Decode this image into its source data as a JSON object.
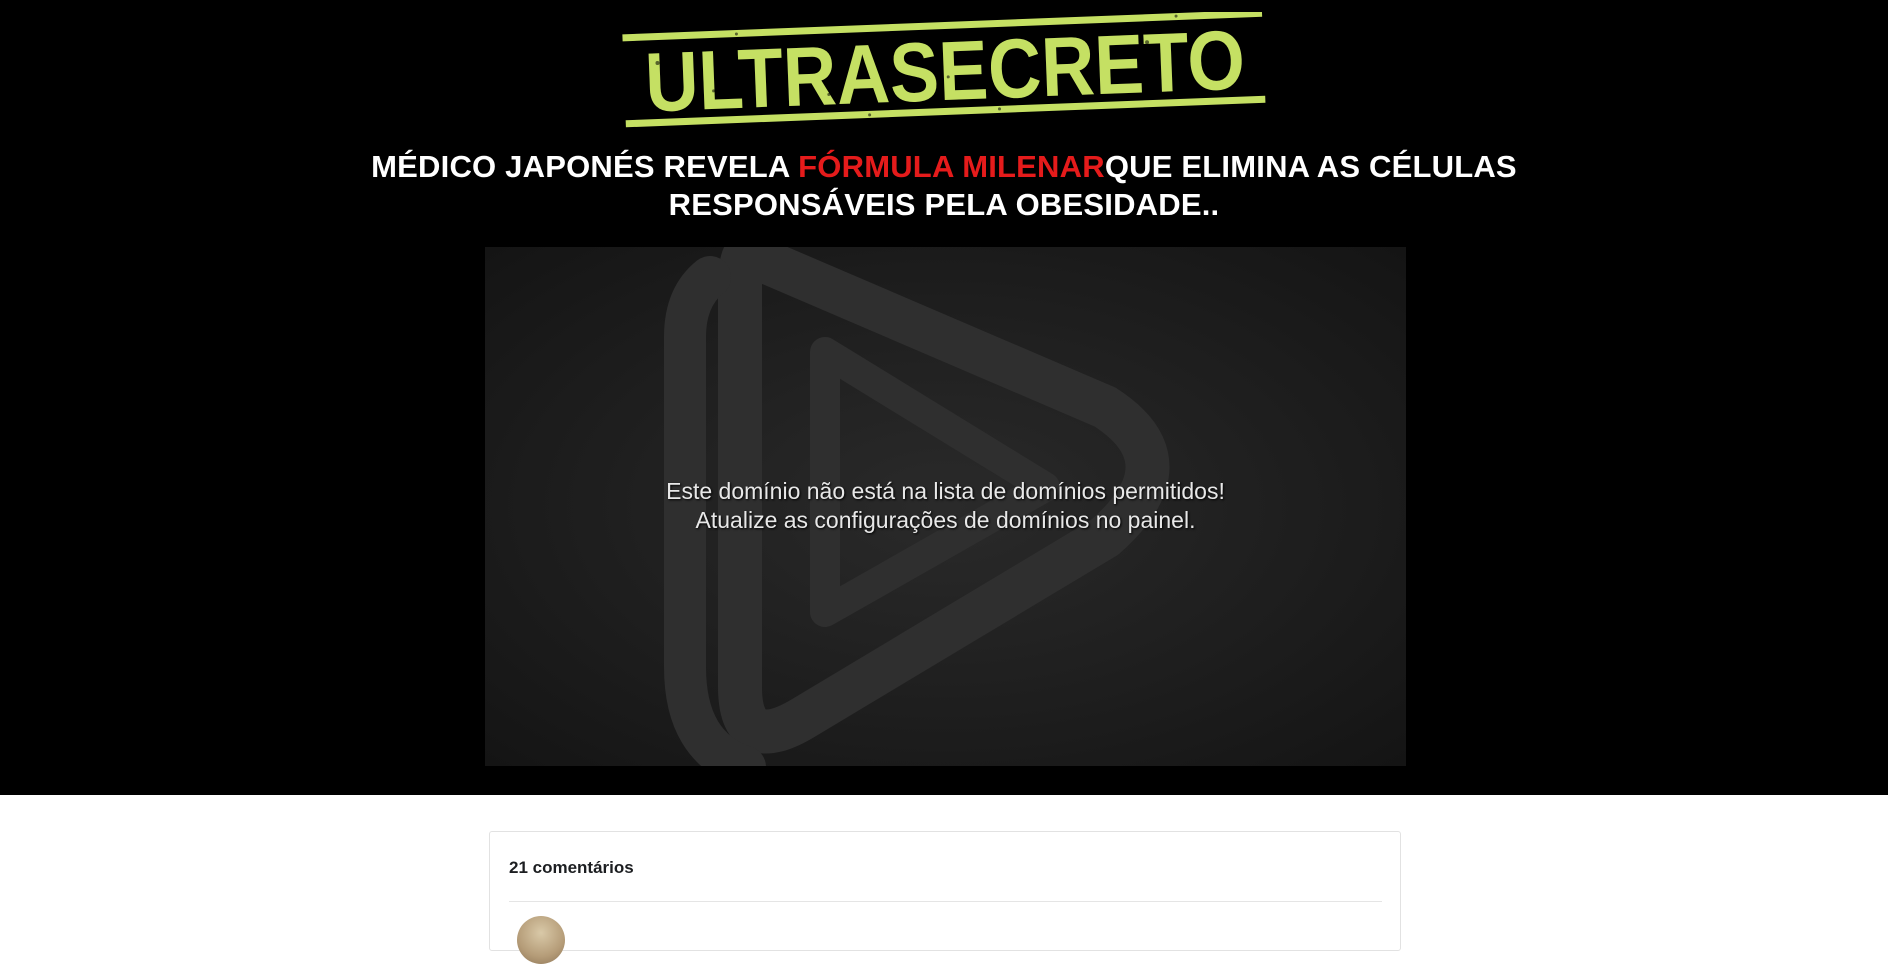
{
  "logo": {
    "text": "ULTRASECRETO",
    "color": "#c5e063"
  },
  "headline": {
    "part1": "MÉDICO JAPONÉS REVELA ",
    "highlight": "FÓRMULA MILENAR",
    "part2": "QUE ELIMINA AS CÉLULAS RESPONSÁVEIS PELA OBESIDADE..",
    "highlight_color": "#e51b1b"
  },
  "video": {
    "icon": "play-icon",
    "message_line1": "Este domínio não está na lista de domínios permitidos!",
    "message_line2": "Atualize as configurações de domínios no painel."
  },
  "comments": {
    "count_label": "21 comentários"
  }
}
